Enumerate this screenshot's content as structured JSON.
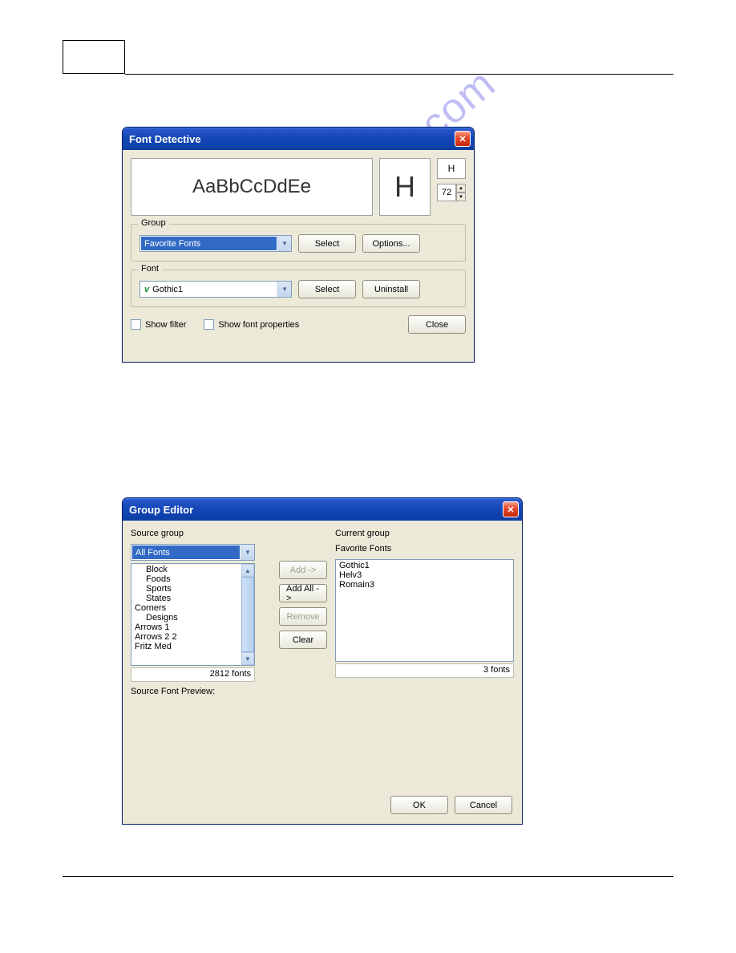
{
  "watermark": "manualshive.com",
  "fontDetective": {
    "title": "Font Detective",
    "previewText": "AaBbCcDdEe",
    "previewChar": "H",
    "charInput": "H",
    "sizeValue": "72",
    "groupSection": {
      "legend": "Group",
      "dropdownValue": "Favorite Fonts",
      "selectBtn": "Select",
      "optionsBtn": "Options..."
    },
    "fontSection": {
      "legend": "Font",
      "dropdownValue": "Gothic1",
      "selectBtn": "Select",
      "uninstallBtn": "Uninstall"
    },
    "showFilter": "Show filter",
    "showFontProps": "Show font properties",
    "closeBtn": "Close"
  },
  "groupEditor": {
    "title": "Group Editor",
    "sourceGroupLabel": "Source group",
    "sourceDropdown": "All Fonts",
    "sourceList": [
      "Block",
      "Foods",
      "Sports",
      "States",
      "Corners",
      "Designs",
      "Arrows 1",
      "Arrows 2 2",
      "Fritz Med"
    ],
    "sourceCount": "2812 fonts",
    "currentGroupLabel": "Current group",
    "currentGroupName": "Favorite Fonts",
    "currentList": [
      "Gothic1",
      "Helv3",
      "Romain3"
    ],
    "currentCount": "3 fonts",
    "previewLabel": "Source Font Preview:",
    "buttons": {
      "add": "Add ->",
      "addAll": "Add All ->",
      "remove": "Remove",
      "clear": "Clear",
      "ok": "OK",
      "cancel": "Cancel"
    }
  }
}
